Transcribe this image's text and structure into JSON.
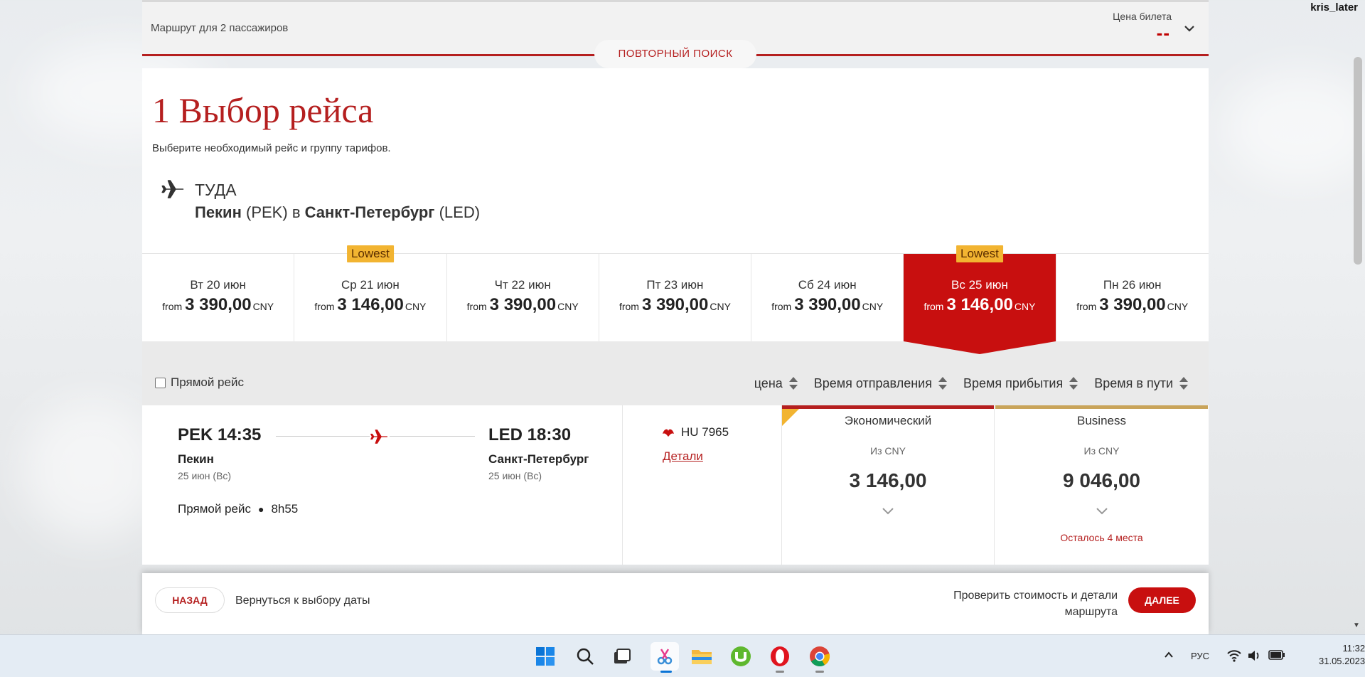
{
  "user": "kris_later",
  "topbar": {
    "route_text": "Маршрут для 2 пассажиров",
    "price_label": "Цена билета",
    "price_value": "--",
    "repeat_search": "ПОВТОРНЫЙ ПОИСК"
  },
  "main": {
    "title": "1 Выбор рейса",
    "subtitle": "Выберите необходимый рейс и группу тарифов.",
    "direction": "ТУДА",
    "from_city": "Пекин",
    "from_code": "(PEK)",
    "to_word": "в",
    "to_city": "Санкт-Петербург",
    "to_code": "(LED)"
  },
  "dates": [
    {
      "day": "Вт 20 июн",
      "from": "from",
      "amount": "3 390,00",
      "currency": "CNY",
      "badge": "",
      "active": false
    },
    {
      "day": "Ср 21 июн",
      "from": "from",
      "amount": "3 146,00",
      "currency": "CNY",
      "badge": "Lowest",
      "active": false
    },
    {
      "day": "Чт 22 июн",
      "from": "from",
      "amount": "3 390,00",
      "currency": "CNY",
      "badge": "",
      "active": false
    },
    {
      "day": "Пт 23 июн",
      "from": "from",
      "amount": "3 390,00",
      "currency": "CNY",
      "badge": "",
      "active": false
    },
    {
      "day": "Сб 24 июн",
      "from": "from",
      "amount": "3 390,00",
      "currency": "CNY",
      "badge": "",
      "active": false
    },
    {
      "day": "Вс 25 июн",
      "from": "from",
      "amount": "3 146,00",
      "currency": "CNY",
      "badge": "Lowest",
      "active": true
    },
    {
      "day": "Пн 26 июн",
      "from": "from",
      "amount": "3 390,00",
      "currency": "CNY",
      "badge": "",
      "active": false
    }
  ],
  "filters": {
    "direct_label": "Прямой рейс",
    "sort_price": "цена",
    "sort_departure": "Время отправления",
    "sort_arrival": "Время прибытия",
    "sort_duration": "Время в пути"
  },
  "flight": {
    "dep_time": "PEK 14:35",
    "dep_city": "Пекин",
    "dep_date": "25 июн (Вс)",
    "arr_time": "LED 18:30",
    "arr_city": "Санкт-Петербург",
    "arr_date": "25 июн (Вс)",
    "direct": "Прямой рейс",
    "duration": "8h55",
    "flight_number": "HU 7965",
    "details": "Детали",
    "fares": [
      {
        "name": "Экономический",
        "from": "Из CNY",
        "amount": "3 146,00",
        "seats": "",
        "color": "#b51f1f"
      },
      {
        "name": "Business",
        "from": "Из CNY",
        "amount": "9 046,00",
        "seats": "Осталось 4 места",
        "color": "#c9a45a"
      }
    ]
  },
  "actionbar": {
    "back": "НАЗАД",
    "back_text": "Вернуться к выбору даты",
    "check_text": "Проверить стоимость и детали маршрута",
    "next": "ДАЛЕЕ"
  },
  "taskbar": {
    "lang": "РУС",
    "time": "11:32",
    "date": "31.05.2023"
  },
  "colors": {
    "brand_red": "#c80f0f",
    "title_red": "#b51f1f",
    "badge_yellow": "#f2b431"
  }
}
